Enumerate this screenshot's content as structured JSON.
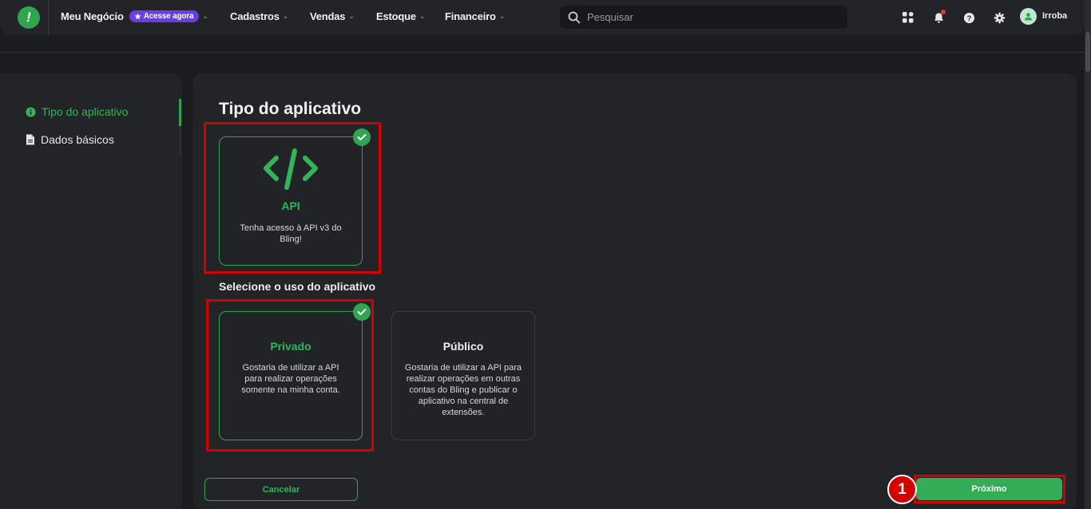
{
  "nav": {
    "items": [
      {
        "label": "Meu Negócio"
      },
      {
        "label": "Cadastros"
      },
      {
        "label": "Vendas"
      },
      {
        "label": "Estoque"
      },
      {
        "label": "Financeiro"
      }
    ],
    "badge": "Acesse agora",
    "search_placeholder": "Pesquisar",
    "user": "Irroba"
  },
  "sidebar": {
    "items": [
      {
        "label": "Tipo do aplicativo",
        "icon": "info-icon",
        "active": true
      },
      {
        "label": "Dados básicos",
        "icon": "document-icon",
        "active": false
      }
    ]
  },
  "main": {
    "title": "Tipo do aplicativo",
    "api_card": {
      "title": "API",
      "description": "Tenha acesso à API v3 do Bling!"
    },
    "usage_title": "Selecione o uso do aplicativo",
    "private_card": {
      "title": "Privado",
      "description": "Gostaria de utilizar a API para realizar operações somente na minha conta."
    },
    "public_card": {
      "title": "Público",
      "description": "Gostaria de utilizar a API para realizar operações em outras contas do Bling e publicar o aplicativo na central de extensões."
    },
    "cancel_label": "Cancelar",
    "next_label": "Próximo",
    "step_number": "1"
  },
  "colors": {
    "accent": "#2fa550",
    "highlight": "#d40000",
    "badge": "#6a3de8"
  }
}
